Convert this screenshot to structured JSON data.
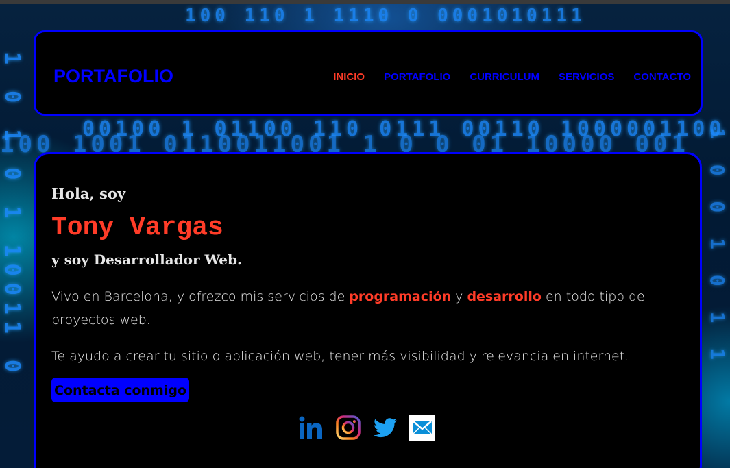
{
  "header": {
    "logo": "PORTAFOLIO",
    "nav": [
      {
        "label": "INICIO",
        "active": true
      },
      {
        "label": "PORTAFOLIO",
        "active": false
      },
      {
        "label": "CURRICULUM",
        "active": false
      },
      {
        "label": "SERVICIOS",
        "active": false
      },
      {
        "label": "CONTACTO",
        "active": false
      }
    ]
  },
  "hero": {
    "greeting": "Hola, soy",
    "name": "Tony Vargas",
    "role": "y soy Desarrollador Web.",
    "paragraph1": {
      "part1": "Vivo en Barcelona, y ofrezco mis servicios de ",
      "highlight1": "programación",
      "part2": " y ",
      "highlight2": "desarrollo",
      "part3": " en todo tipo de proyectos web."
    },
    "paragraph2": "Te ayudo a crear tu sitio o aplicación web, tener más visibilidad y relevancia en internet.",
    "cta_label": "Contacta conmigo"
  },
  "socials": [
    {
      "name": "linkedin-icon"
    },
    {
      "name": "instagram-icon"
    },
    {
      "name": "twitter-icon"
    },
    {
      "name": "email-icon"
    }
  ],
  "background_digits": [
    "100 110 1 1110 0 0001010111",
    "1 0 1 0 1 10011 0",
    "00100 1 01100 110 0111 00110 1000001100",
    "100 1001 0110011001 1 0 0 01 10000 001",
    "1 0 0 1 0 1 1"
  ],
  "colors": {
    "accent": "#ff3c28",
    "brand_blue": "#0000ff",
    "card_bg": "#000000",
    "text": "#e6e6e6"
  }
}
